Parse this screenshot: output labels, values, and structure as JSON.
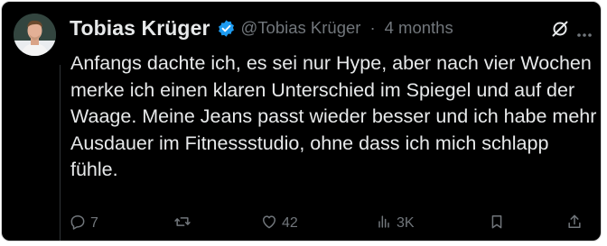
{
  "tweet": {
    "author_name": "Tobias Krüger",
    "handle": "@Tobias Krüger",
    "separator": "·",
    "time": "4 months",
    "text": "Anfangs dachte ich, es sei nur Hype, aber nach vier Wochen merke ich einen klaren Unterschied im Spiegel und auf der Waage. Meine Jeans passt wieder besser und ich habe mehr Ausdauer im Fitnessstudio, ohne dass ich mich schlapp fühle."
  },
  "actions": {
    "reply_count": "7",
    "repost_count": "",
    "like_count": "42",
    "views_count": "3K"
  },
  "icons": {
    "verified": "verified-badge-icon",
    "grok": "grok-icon",
    "more": "more-icon",
    "reply": "reply-icon",
    "repost": "repost-icon",
    "like": "heart-icon",
    "views": "views-icon",
    "bookmark": "bookmark-icon",
    "share": "share-icon"
  },
  "colors": {
    "background": "#000000",
    "text": "#e7e9ea",
    "secondary": "#71767b",
    "verified": "#1d9bf0"
  }
}
